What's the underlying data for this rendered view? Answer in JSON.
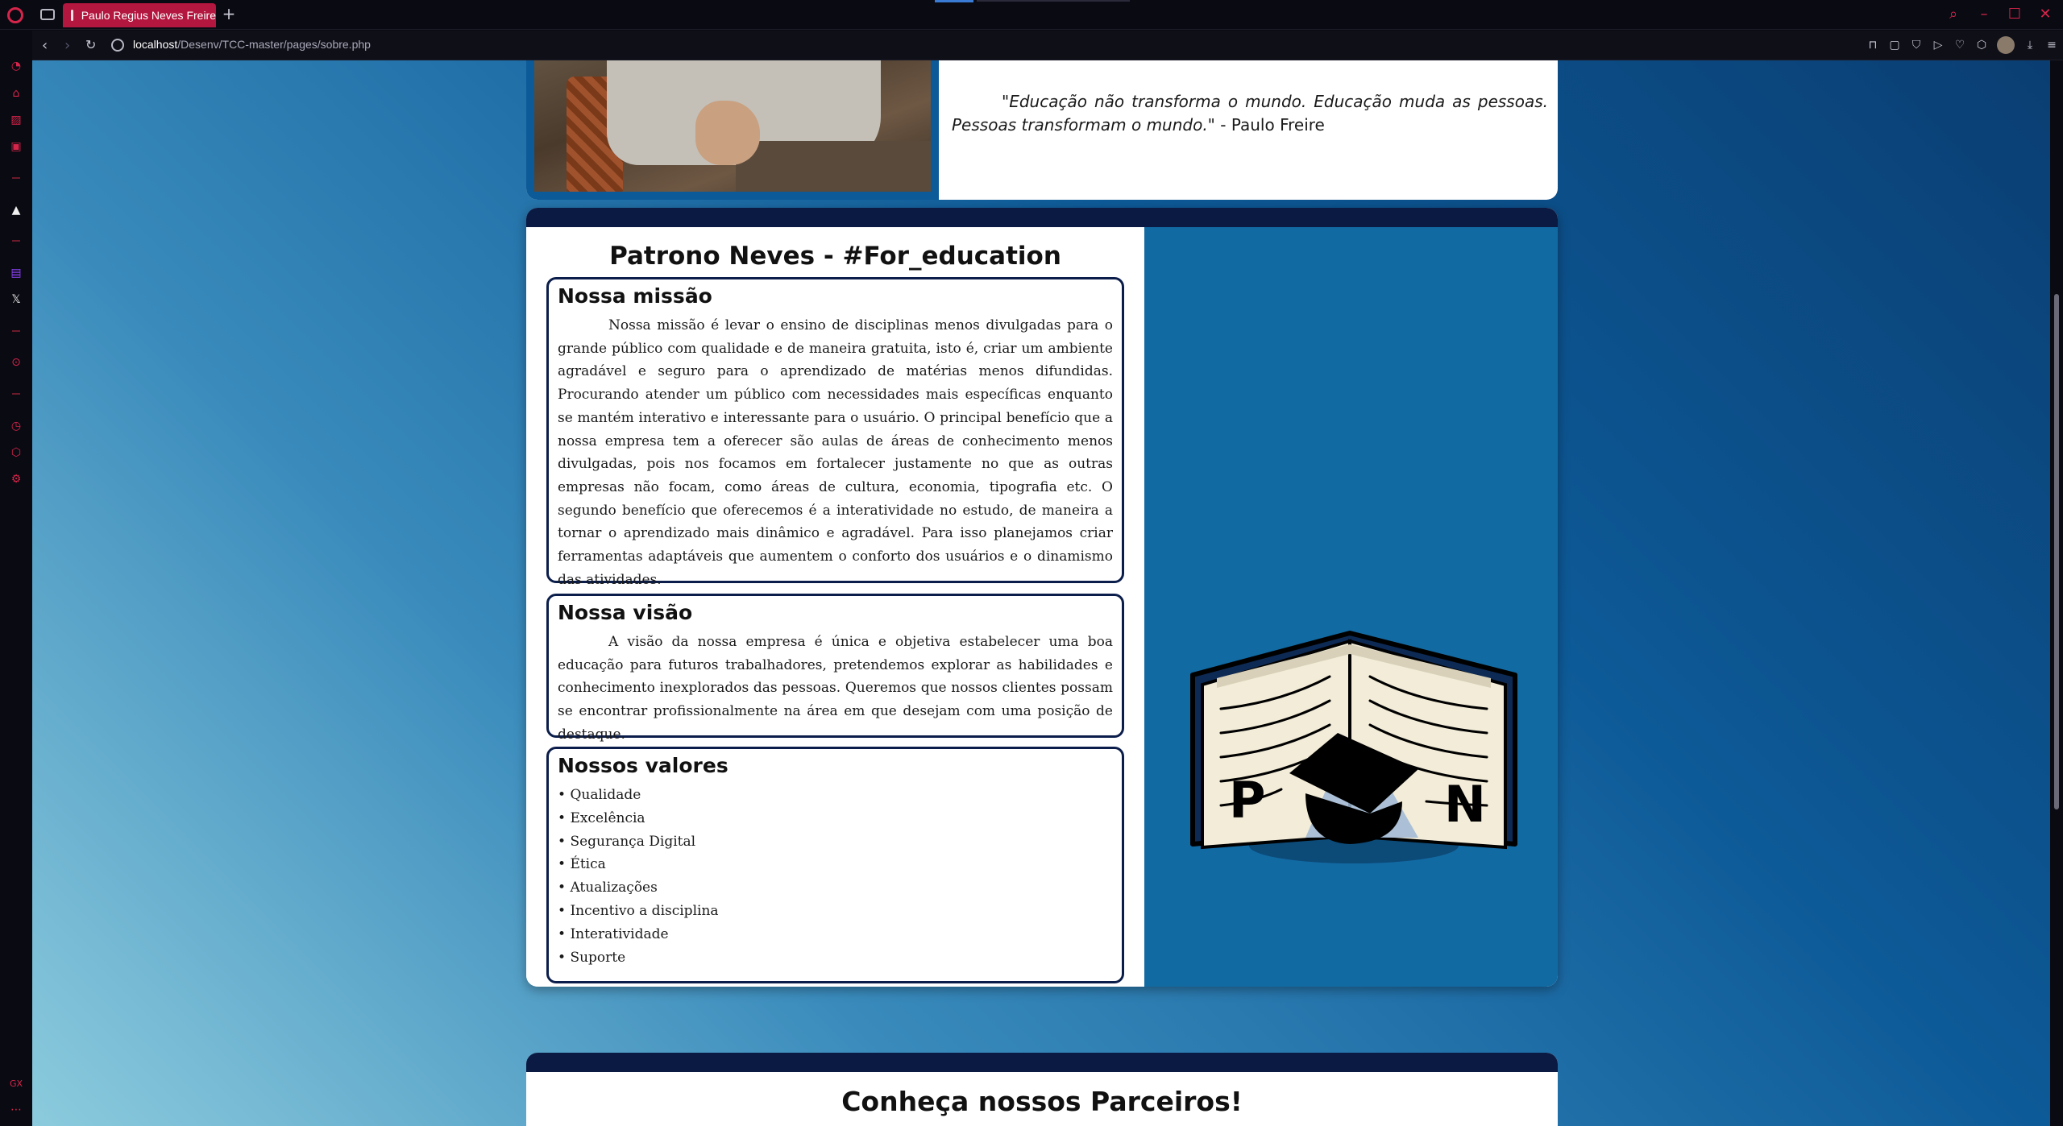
{
  "browser": {
    "tab_title": "Paulo Regius Neves Freire",
    "new_tab_symbol": "+",
    "url_host": "localhost",
    "url_path": "/Desenv/TCC-master/pages/sobre.php"
  },
  "quote": {
    "text": "\"Educação não transforma o mundo. Educação muda as pessoas. Pessoas transformam o mundo.\"",
    "author": " - Paulo Freire"
  },
  "about": {
    "title": "Patrono Neves - #For_education",
    "missao": {
      "heading": "Nossa missão",
      "text": "Nossa missão é levar o ensino de disciplinas menos divulgadas para o grande público com qualidade e de maneira gratuita, isto é, criar um ambiente agradável e seguro para o aprendizado de matérias menos difundidas. Procurando atender um público com necessidades mais específicas enquanto se mantém interativo e interessante para o usuário. O principal benefício que a nossa empresa tem a oferecer são aulas de áreas de conhecimento menos divulgadas, pois nos focamos em fortalecer justamente no que as outras empresas não focam, como áreas de cultura, economia, tipografia etc. O segundo benefício que oferecemos é a interatividade no estudo, de maneira a tornar o aprendizado mais dinâmico e agradável. Para isso planejamos criar ferramentas adaptáveis que aumentem o conforto dos usuários e o dinamismo das atividades."
    },
    "visao": {
      "heading": "Nossa visão",
      "text": "A visão da nossa empresa é única e objetiva estabelecer uma boa educação para futuros trabalhadores, pretendemos explorar as habilidades e conhecimento inexplorados das pessoas. Queremos que nossos clientes possam se encontrar profissionalmente na área em que desejam com uma posição de destaque."
    },
    "valores": {
      "heading": "Nossos valores",
      "items": [
        "Qualidade",
        "Excelência",
        "Segurança Digital",
        "Ética",
        "Atualizações",
        "Incentivo a disciplina",
        "Interatividade",
        "Suporte"
      ]
    },
    "logo": {
      "left_letter": "P",
      "right_letter": "N"
    }
  },
  "partners": {
    "title": "Conheça nossos Parceiros!"
  },
  "colors": {
    "accent": "#d6254b",
    "navy": "#0a1a42",
    "panel_blue": "#126aa3"
  }
}
